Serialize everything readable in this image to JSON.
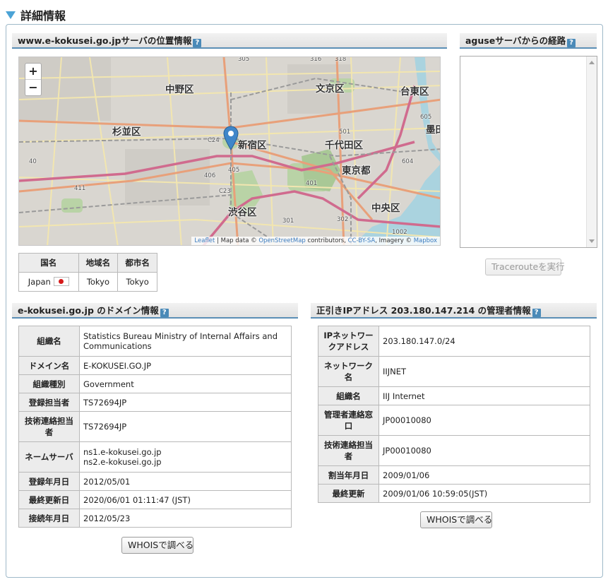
{
  "heading": "詳細情報",
  "geo": {
    "title": "www.e-kokusei.go.jpサーバの位置情報",
    "help": "?",
    "map": {
      "zoom_in": "+",
      "zoom_out": "−",
      "labels": [
        "中野区",
        "文京区",
        "台東区",
        "杉並区",
        "新宿区",
        "千代田区",
        "東京都",
        "墨田",
        "渋谷区",
        "中央区"
      ],
      "road_numbers": [
        "C24",
        "501",
        "406",
        "405",
        "C23",
        "605",
        "604",
        "401",
        "302",
        "301",
        "1002",
        "411",
        "40",
        "316",
        "318",
        "305"
      ],
      "attribution": {
        "leaflet": "Leaflet",
        "sep1": " | Map data © ",
        "osm": "OpenStreetMap",
        "sep2": " contributors, ",
        "license": "CC-BY-SA",
        "sep3": ", Imagery © ",
        "mapbox": "Mapbox"
      }
    },
    "table": {
      "headers": [
        "国名",
        "地域名",
        "都市名"
      ],
      "row": {
        "country": "Japan",
        "region": "Tokyo",
        "city": "Tokyo"
      }
    }
  },
  "route": {
    "title": "aguseサーバからの経路",
    "help": "?",
    "button": "Tracerouteを実行"
  },
  "domain": {
    "title": "e-kokusei.go.jp のドメイン情報",
    "help": "?",
    "rows": [
      {
        "label": "組織名",
        "value": "Statistics Bureau Ministry of Internal Affairs and Communications"
      },
      {
        "label": "ドメイン名",
        "value": "E-KOKUSEI.GO.JP"
      },
      {
        "label": "組織種別",
        "value": "Government"
      },
      {
        "label": "登録担当者",
        "value": "TS72694JP"
      },
      {
        "label": "技術連絡担当者",
        "value": "TS72694JP"
      },
      {
        "label": "ネームサーバ",
        "value": "ns1.e-kokusei.go.jp",
        "value2": "ns2.e-kokusei.go.jp"
      },
      {
        "label": "登録年月日",
        "value": "2012/05/01"
      },
      {
        "label": "最終更新日",
        "value": "2020/06/01 01:11:47 (JST)"
      },
      {
        "label": "接続年月日",
        "value": "2012/05/23"
      }
    ],
    "button": "WHOISで調べる"
  },
  "ip": {
    "title": "正引きIPアドレス 203.180.147.214 の管理者情報",
    "help": "?",
    "rows": [
      {
        "label": "IPネットワークアドレス",
        "value": "203.180.147.0/24"
      },
      {
        "label": "ネットワーク名",
        "value": "IIJNET"
      },
      {
        "label": "組織名",
        "value": "IIJ Internet"
      },
      {
        "label": "管理者連絡窓口",
        "value": "JP00010080"
      },
      {
        "label": "技術連絡担当者",
        "value": "JP00010080"
      },
      {
        "label": "割当年月日",
        "value": "2009/01/06"
      },
      {
        "label": "最終更新",
        "value": "2009/01/06 10:59:05(JST)"
      }
    ],
    "button": "WHOISで調べる"
  }
}
